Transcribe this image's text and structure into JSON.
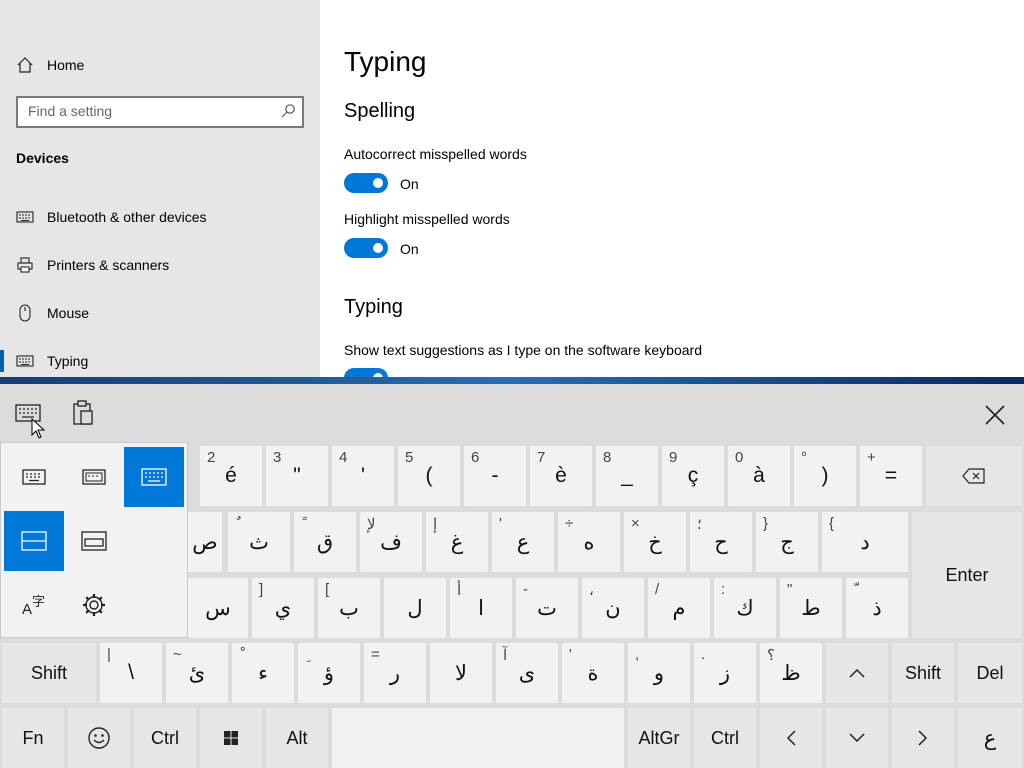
{
  "sidebar": {
    "home": "Home",
    "search_placeholder": "Find a setting",
    "section": "Devices",
    "items": [
      {
        "label": "Bluetooth & other devices",
        "icon": "keyboard-icon"
      },
      {
        "label": "Printers & scanners",
        "icon": "printer-icon"
      },
      {
        "label": "Mouse",
        "icon": "mouse-icon"
      },
      {
        "label": "Typing",
        "icon": "keyboard-icon"
      }
    ]
  },
  "main": {
    "title": "Typing",
    "spelling_heading": "Spelling",
    "autocorrect_label": "Autocorrect misspelled words",
    "autocorrect_state": "On",
    "highlight_label": "Highlight misspelled words",
    "highlight_state": "On",
    "typing_heading": "Typing",
    "suggestions_label": "Show text suggestions as I type on the software keyboard"
  },
  "keyboard": {
    "accent_color": "#0078d7",
    "row1": [
      {
        "main": "é",
        "sub": "2"
      },
      {
        "main": "\"",
        "sub": "3"
      },
      {
        "main": "'",
        "sub": "4"
      },
      {
        "main": "(",
        "sub": "5"
      },
      {
        "main": "-",
        "sub": "6"
      },
      {
        "main": "è",
        "sub": "7"
      },
      {
        "main": "_",
        "sub": "8"
      },
      {
        "main": "ç",
        "sub": "9"
      },
      {
        "main": "à",
        "sub": "0"
      },
      {
        "main": ")",
        "sub": "°"
      },
      {
        "main": "=",
        "sub": "+"
      }
    ],
    "row2": [
      {
        "main": "ص",
        "sub": ""
      },
      {
        "main": "ث",
        "sub": "ٌ"
      },
      {
        "main": "ق",
        "sub": "ً"
      },
      {
        "main": "ف",
        "sub": "لإ"
      },
      {
        "main": "غ",
        "sub": "إ"
      },
      {
        "main": "ع",
        "sub": "'"
      },
      {
        "main": "ه",
        "sub": "÷"
      },
      {
        "main": "خ",
        "sub": "×"
      },
      {
        "main": "ح",
        "sub": "؛"
      },
      {
        "main": "ج",
        "sub": "}"
      },
      {
        "main": "د",
        "sub": "{"
      }
    ],
    "row3": [
      {
        "main": "س",
        "sub": ""
      },
      {
        "main": "ي",
        "sub": "]"
      },
      {
        "main": "ب",
        "sub": "["
      },
      {
        "main": "ل",
        "sub": ""
      },
      {
        "main": "ا",
        "sub": "أ"
      },
      {
        "main": "ت",
        "sub": "-"
      },
      {
        "main": "ن",
        "sub": "،"
      },
      {
        "main": "م",
        "sub": "/"
      },
      {
        "main": "ك",
        "sub": ":"
      },
      {
        "main": "ط",
        "sub": "\""
      },
      {
        "main": "ذ",
        "sub": "ّ"
      }
    ],
    "row4": [
      {
        "main": "\\",
        "sub": "|"
      },
      {
        "main": "ئ",
        "sub": "~"
      },
      {
        "main": "ء",
        "sub": "ْ"
      },
      {
        "main": "ؤ",
        "sub": "ِ"
      },
      {
        "main": "ر",
        "sub": "="
      },
      {
        "main": "لا",
        "sub": ""
      },
      {
        "main": "ى",
        "sub": "آ"
      },
      {
        "main": "ة",
        "sub": "'"
      },
      {
        "main": "و",
        "sub": ","
      },
      {
        "main": "ز",
        "sub": "."
      },
      {
        "main": "ظ",
        "sub": "؟"
      }
    ],
    "enter": "Enter",
    "shift_left": "Shift",
    "shift_right": "Shift",
    "del": "Del",
    "fn": "Fn",
    "ctrl_left": "Ctrl",
    "alt": "Alt",
    "altgr": "AltGr",
    "ctrl_right": "Ctrl",
    "lang": "ع"
  }
}
